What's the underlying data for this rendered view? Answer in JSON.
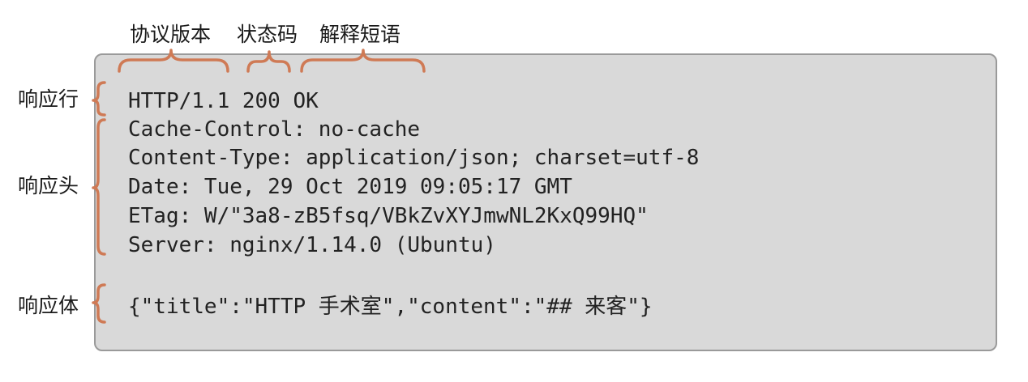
{
  "labels": {
    "version": "协议版本",
    "status_code": "状态码",
    "reason_phrase": "解释短语",
    "status_line": "响应行",
    "headers": "响应头",
    "body": "响应体"
  },
  "status_line": "HTTP/1.1 200 OK",
  "headers": [
    "Cache-Control: no-cache",
    "Content-Type: application/json; charset=utf-8",
    "Date: Tue, 29 Oct 2019 09:05:17 GMT",
    "ETag: W/\"3a8-zB5fsq/VBkZvXYJmwNL2KxQ99HQ\"",
    "Server: nginx/1.14.0 (Ubuntu)"
  ],
  "body": "{\"title\":\"HTTP 手术室\",\"content\":\"## 来客\"}",
  "colors": {
    "brace": "#cf7a55",
    "box_fill": "#d9d9d9",
    "box_border": "#9a9a9a",
    "text": "#222222"
  }
}
